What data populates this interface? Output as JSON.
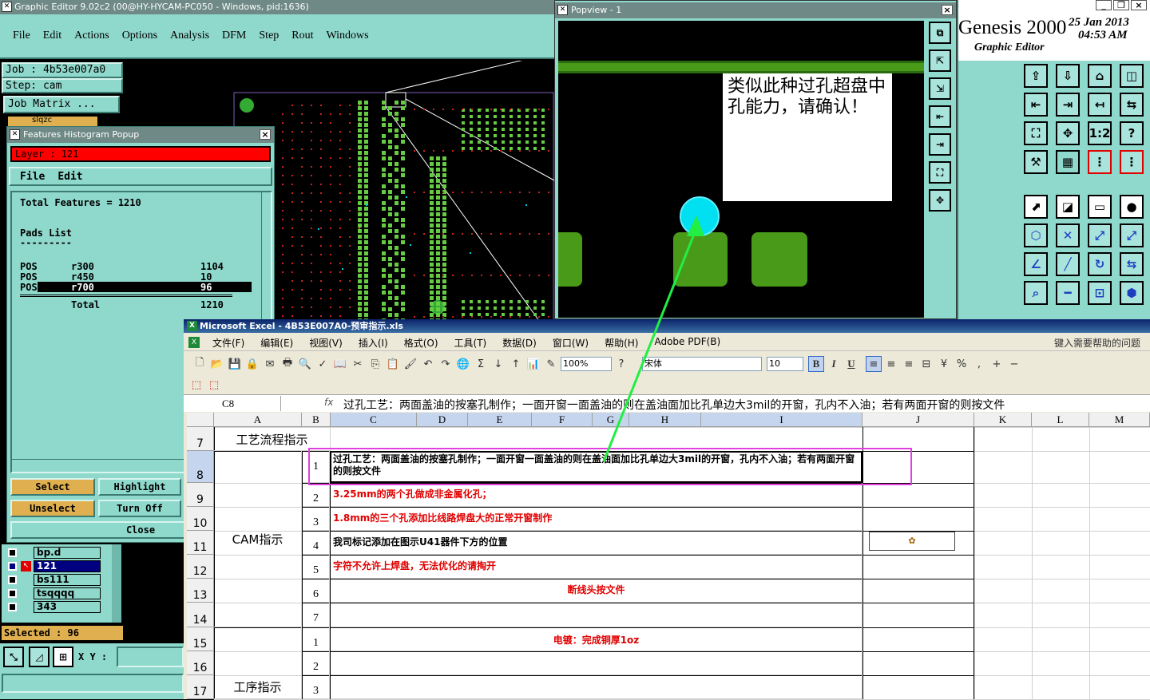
{
  "ge": {
    "title": "Graphic Editor 9.02c2 (00@HY-HYCAM-PC050 - Windows, pid:1636)",
    "menu": [
      "File",
      "Edit",
      "Actions",
      "Options",
      "Analysis",
      "DFM",
      "Step",
      "Rout",
      "Windows"
    ],
    "job": "Job : 4b53e007a0",
    "step": "Step: cam",
    "job_matrix": "Job Matrix ...",
    "layer_top": "slqzc",
    "layers": [
      {
        "name": "bp.d"
      },
      {
        "name": "121"
      },
      {
        "name": "bs111"
      },
      {
        "name": "tsqqqq"
      },
      {
        "name": "343"
      }
    ],
    "selected": "Selected : 96",
    "xy_label": "X Y :"
  },
  "hist": {
    "title": "Features Histogram Popup",
    "layer": "Layer : 121",
    "menu": [
      "File",
      "Edit"
    ],
    "total_features": "Total Features = 1210",
    "pads_list": "Pads List",
    "dashes": "---------",
    "rows": [
      {
        "type": "POS",
        "sym": "r300",
        "count": "1104"
      },
      {
        "type": "POS",
        "sym": "r450",
        "count": "10"
      },
      {
        "type": "POS",
        "sym": "r700",
        "count": "96"
      }
    ],
    "total_label": "Total",
    "total_value": "1210",
    "buttons": {
      "select": "Select",
      "highlight": "Highlight",
      "unselect": "Unselect",
      "turn_off": "Turn Off",
      "close": "Close"
    }
  },
  "popview": {
    "title": "Popview - 1",
    "note": "类似此种过孔超盘中孔能力，请确认！"
  },
  "genesis": {
    "name": "Genesis 2000",
    "date": "25 Jan 2013",
    "time": "04:53 AM",
    "subtitle": "Graphic Editor",
    "icons": [
      "export",
      "import",
      "home",
      "split",
      "left",
      "right",
      "swap-left",
      "swap",
      "fit",
      "center",
      "1:2",
      "help",
      "align-left",
      "grid",
      "scale-a",
      "scale-b"
    ],
    "icons2": [
      "move",
      "draw",
      "ruler",
      "dot",
      "link",
      "cross",
      "connect",
      "connect2",
      "angle",
      "line",
      "rotate",
      "mirror",
      "zoom",
      "cut",
      "measure",
      "group"
    ],
    "icon_texts": {
      "ratio": "1:2",
      "help": "?"
    }
  },
  "excel": {
    "title": "Microsoft Excel - 4B53E007A0-预审指示.xls",
    "menu": [
      "文件(F)",
      "编辑(E)",
      "视图(V)",
      "插入(I)",
      "格式(O)",
      "工具(T)",
      "数据(D)",
      "窗口(W)",
      "帮助(H)",
      "Adobe PDF(B)"
    ],
    "help_placeholder": "键入需要帮助的问题",
    "zoom": "100%",
    "font": "宋体",
    "size": "10",
    "name_box": "C8",
    "fx": "fx",
    "formula": "过孔工艺：两面盖油的按塞孔制作；一面开窗一面盖油的则在盖油面加比孔单边大3mil的开窗，孔内不入油；若有两面开窗的则按文件",
    "columns": [
      "A",
      "B",
      "C",
      "D",
      "E",
      "F",
      "G",
      "H",
      "I",
      "J",
      "K",
      "L",
      "M"
    ],
    "rows": [
      "7",
      "8",
      "9",
      "10",
      "11",
      "12",
      "13",
      "14",
      "15",
      "16",
      "17"
    ],
    "a_labels": {
      "r7": "工艺流程指示",
      "cam": "CAM指示",
      "proc": "工序指示"
    },
    "cam_items": [
      {
        "n": "1",
        "text": "过孔工艺：两面盖油的按塞孔制作；一面开窗一面盖油的则在盖油面加比孔单边大3mil的开窗，孔内不入油；若有两面开窗的则按文件",
        "color": "#000000"
      },
      {
        "n": "2",
        "text": "3.25mm的两个孔做成非金属化孔；",
        "color": "#e00000"
      },
      {
        "n": "3",
        "text": "1.8mm的三个孔添加比线路焊盘大的正常开窗制作",
        "color": "#e00000"
      },
      {
        "n": "4",
        "text": "我司标记添加在图示U41器件下方的位置",
        "color": "#000000"
      },
      {
        "n": "5",
        "text": "字符不允许上焊盘，无法优化的请掏开",
        "color": "#e00000"
      },
      {
        "n": "6",
        "text": "断线头按文件",
        "color": "#e00000"
      },
      {
        "n": "7",
        "text": "",
        "color": "#000000"
      }
    ],
    "proc_items": [
      {
        "n": "1",
        "text": "电镀：完成铜厚1oz",
        "color": "#e00000"
      },
      {
        "n": "2",
        "text": ""
      },
      {
        "n": "3",
        "text": ""
      }
    ],
    "bold": "B",
    "italic": "I",
    "underline": "U"
  }
}
